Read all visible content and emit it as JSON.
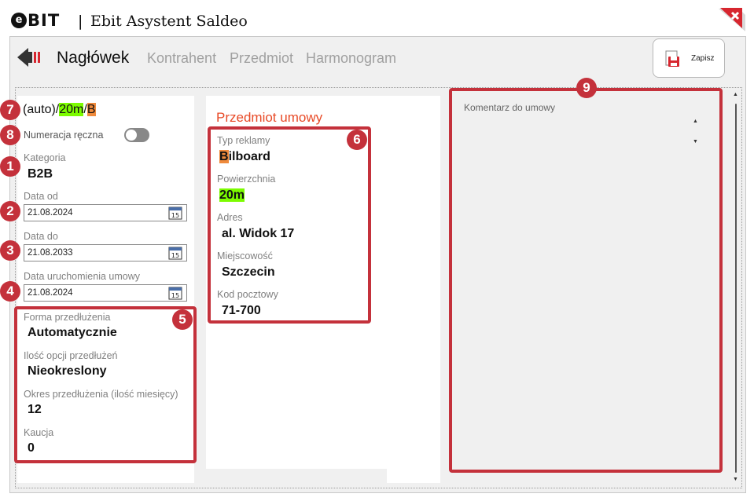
{
  "app": {
    "logo_text": "BIT",
    "logo_letter": "e",
    "separator": "|",
    "title": "Ebit Asystent Saldeo"
  },
  "toolbar": {
    "tabs": [
      {
        "label": "Nagłówek",
        "active": true
      },
      {
        "label": "Kontrahent",
        "active": false
      },
      {
        "label": "Przedmiot",
        "active": false
      },
      {
        "label": "Harmonogram",
        "active": false
      }
    ],
    "save_label": "Zapisz",
    "back_icon": "back-arrow-icon",
    "save_icon": "save-document-icon"
  },
  "left": {
    "number_prefix": "(auto)/",
    "number_area": "20m",
    "number_sep": "/",
    "number_type": "B",
    "numeracja_label": "Numeracja ręczna",
    "numeracja_on": false,
    "kategoria_label": "Kategoria",
    "kategoria_value": "B2B",
    "data_od_label": "Data od",
    "data_od_value": "21.08.2024",
    "data_do_label": "Data do",
    "data_do_value": "21.08.2033",
    "data_uruch_label": "Data uruchomienia umowy",
    "data_uruch_value": "21.08.2024",
    "calendar_day": "15",
    "forma_label": "Forma przedłużenia",
    "forma_value": "Automatycznie",
    "ilosc_label": "Ilość opcji przedłużeń",
    "ilosc_value": "Nieokreslony",
    "okres_label": "Okres przedłużenia (ilość miesięcy)",
    "okres_value": "12",
    "kaucja_label": "Kaucja",
    "kaucja_value": "0"
  },
  "middle": {
    "section_title": "Przedmiot umowy",
    "typ_label": "Typ reklamy",
    "typ_value_first": "B",
    "typ_value_rest": "ilboard",
    "pow_label": "Powierzchnia",
    "pow_value": "20m",
    "adres_label": "Adres",
    "adres_value": "al. Widok 17",
    "miejsc_label": "Miejscowość",
    "miejsc_value": "Szczecin",
    "kod_label": "Kod pocztowy",
    "kod_value": "71-700"
  },
  "right": {
    "komentarz_label": "Komentarz do umowy",
    "up_arrow": "▲",
    "down_arrow": "▼"
  },
  "annotations": [
    "1",
    "2",
    "3",
    "4",
    "5",
    "6",
    "7",
    "8",
    "9"
  ],
  "colors": {
    "annotation_red": "#c4313b",
    "section_title_orange": "#e84a27",
    "highlight_green": "#7cfc00",
    "highlight_orange": "#ef8a3c"
  }
}
